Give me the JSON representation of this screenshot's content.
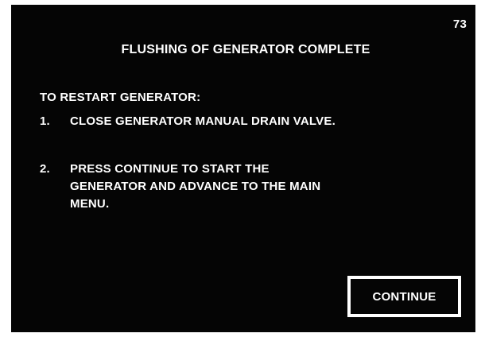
{
  "screen": {
    "number": "73",
    "title": "FLUSHING OF GENERATOR COMPLETE",
    "background_color": "#050505",
    "text_color": "#ffffff"
  },
  "instructions": {
    "heading": "TO RESTART GENERATOR:",
    "steps": [
      {
        "number": "1.",
        "text": "CLOSE GENERATOR MANUAL DRAIN VALVE."
      },
      {
        "number": "2.",
        "text": "PRESS CONTINUE TO START THE GENERATOR AND ADVANCE TO THE MAIN MENU."
      }
    ]
  },
  "buttons": {
    "continue_label": "CONTINUE"
  }
}
